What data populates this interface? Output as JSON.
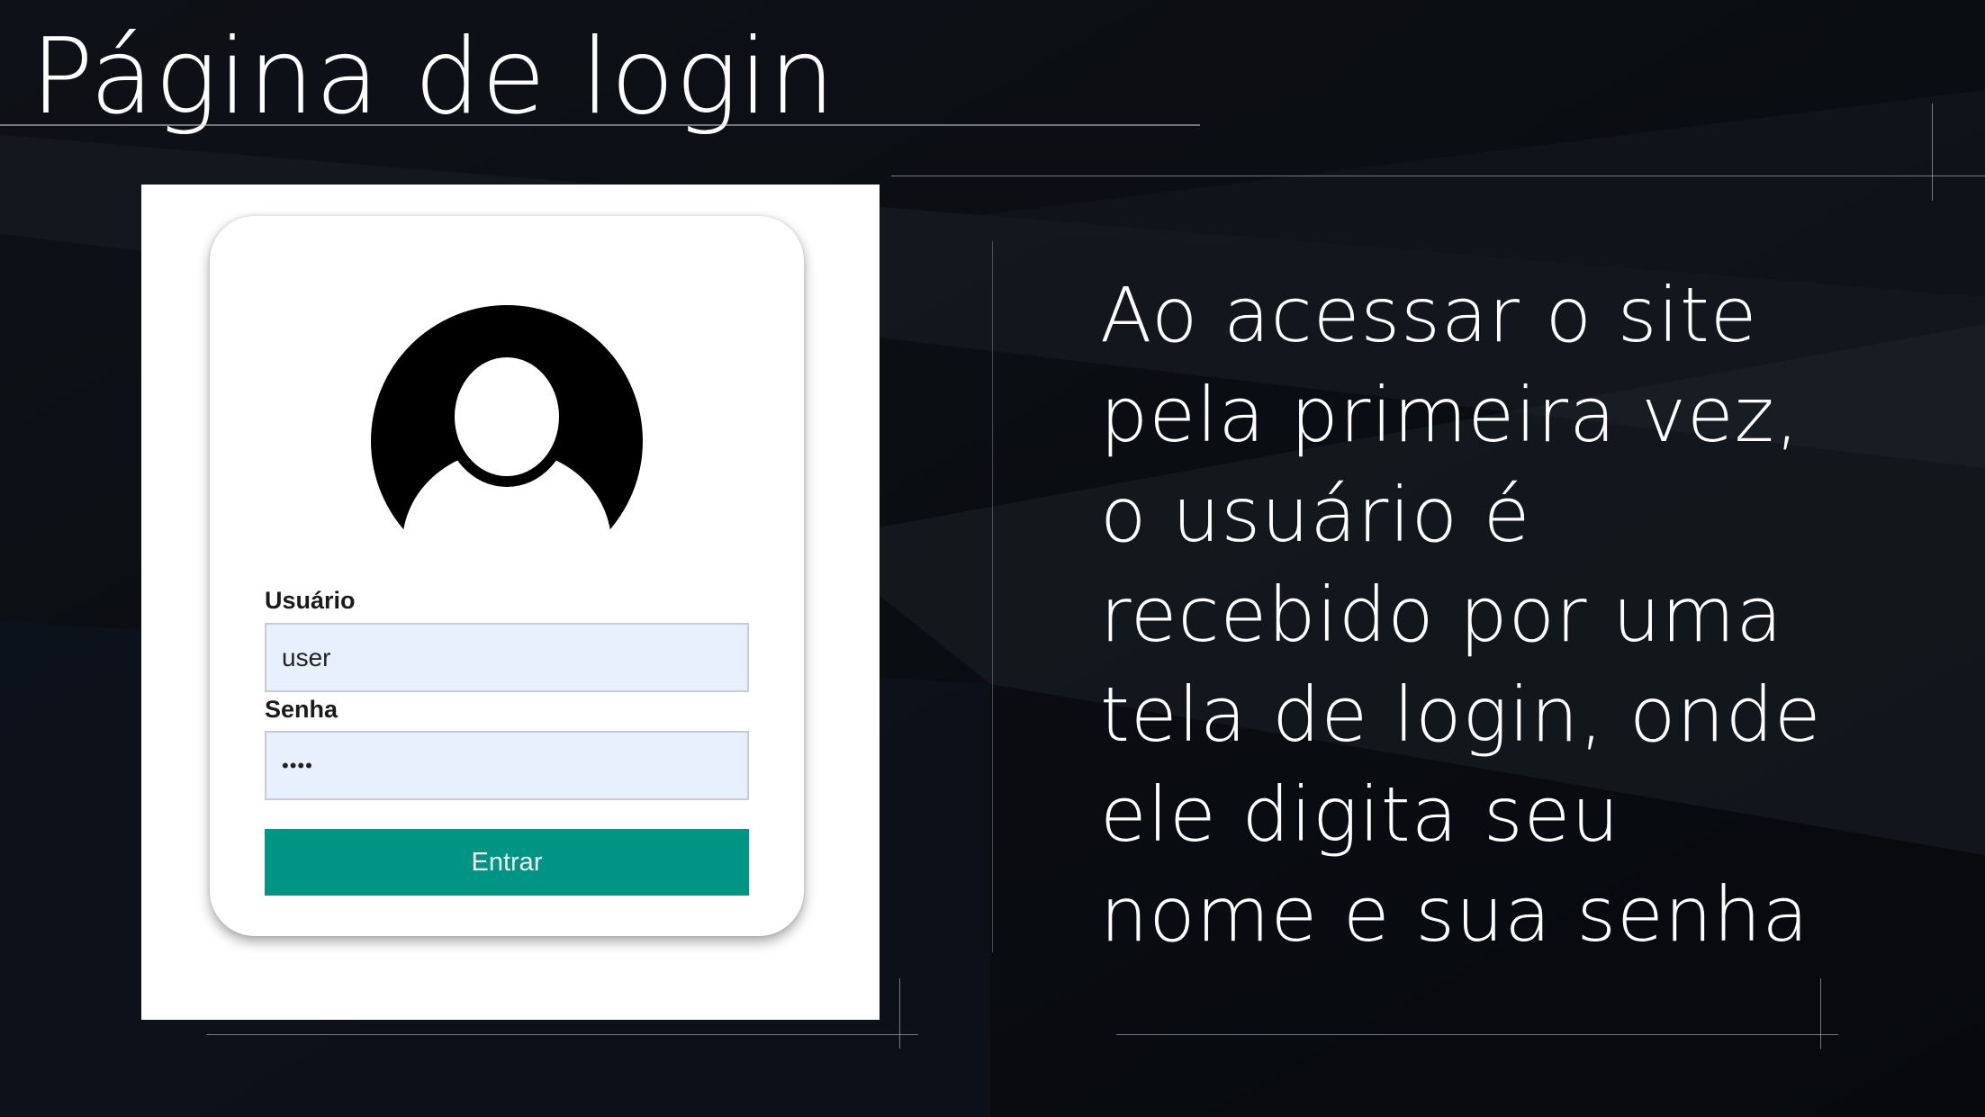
{
  "slide": {
    "title": "Página de login",
    "description_lines": [
      "Ao acessar o site",
      "pela primeira vez,",
      "o usuário é",
      "recebido por uma",
      "tela de login, onde",
      "ele digita seu",
      "nome e sua senha"
    ]
  },
  "login_form": {
    "avatar_icon": "user-avatar-icon",
    "username": {
      "label": "Usuário",
      "value": "user"
    },
    "password": {
      "label": "Senha",
      "value": "••••"
    },
    "submit_label": "Entrar",
    "button_color": "#009485",
    "input_bg_color": "#e8f0fe"
  }
}
